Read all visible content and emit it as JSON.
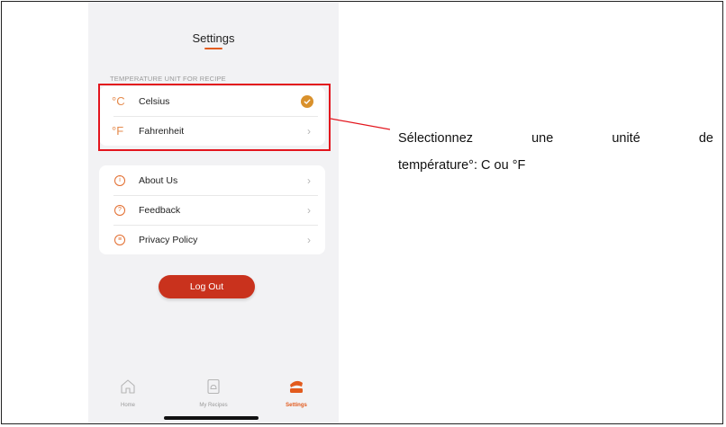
{
  "header": {
    "title": "Settings"
  },
  "temperature": {
    "section_label": "TEMPERATURE UNIT FOR RECIPE",
    "options": [
      {
        "unit_symbol": "°C",
        "label": "Celsius",
        "selected": true
      },
      {
        "unit_symbol": "°F",
        "label": "Fahrenheit",
        "selected": false
      }
    ]
  },
  "menu": {
    "items": [
      {
        "label": "About Us",
        "icon": "info-icon"
      },
      {
        "label": "Feedback",
        "icon": "question-icon"
      },
      {
        "label": "Privacy Policy",
        "icon": "document-icon"
      }
    ]
  },
  "logout_label": "Log Out",
  "tabbar": {
    "tabs": [
      {
        "label": "Home",
        "icon": "home-icon",
        "active": false
      },
      {
        "label": "My Recipes",
        "icon": "recipe-book-icon",
        "active": false
      },
      {
        "label": "Settings",
        "icon": "settings-pot-icon",
        "active": true
      }
    ]
  },
  "annotation": {
    "words_line1": [
      "Sélectionnez",
      "une",
      "unité",
      "de"
    ],
    "line2": "température°: C ou °F"
  },
  "colors": {
    "accent": "#e25b1e",
    "checkmark": "#d9912c",
    "logout_button": "#c9321d",
    "highlight_box": "#e3151d"
  }
}
